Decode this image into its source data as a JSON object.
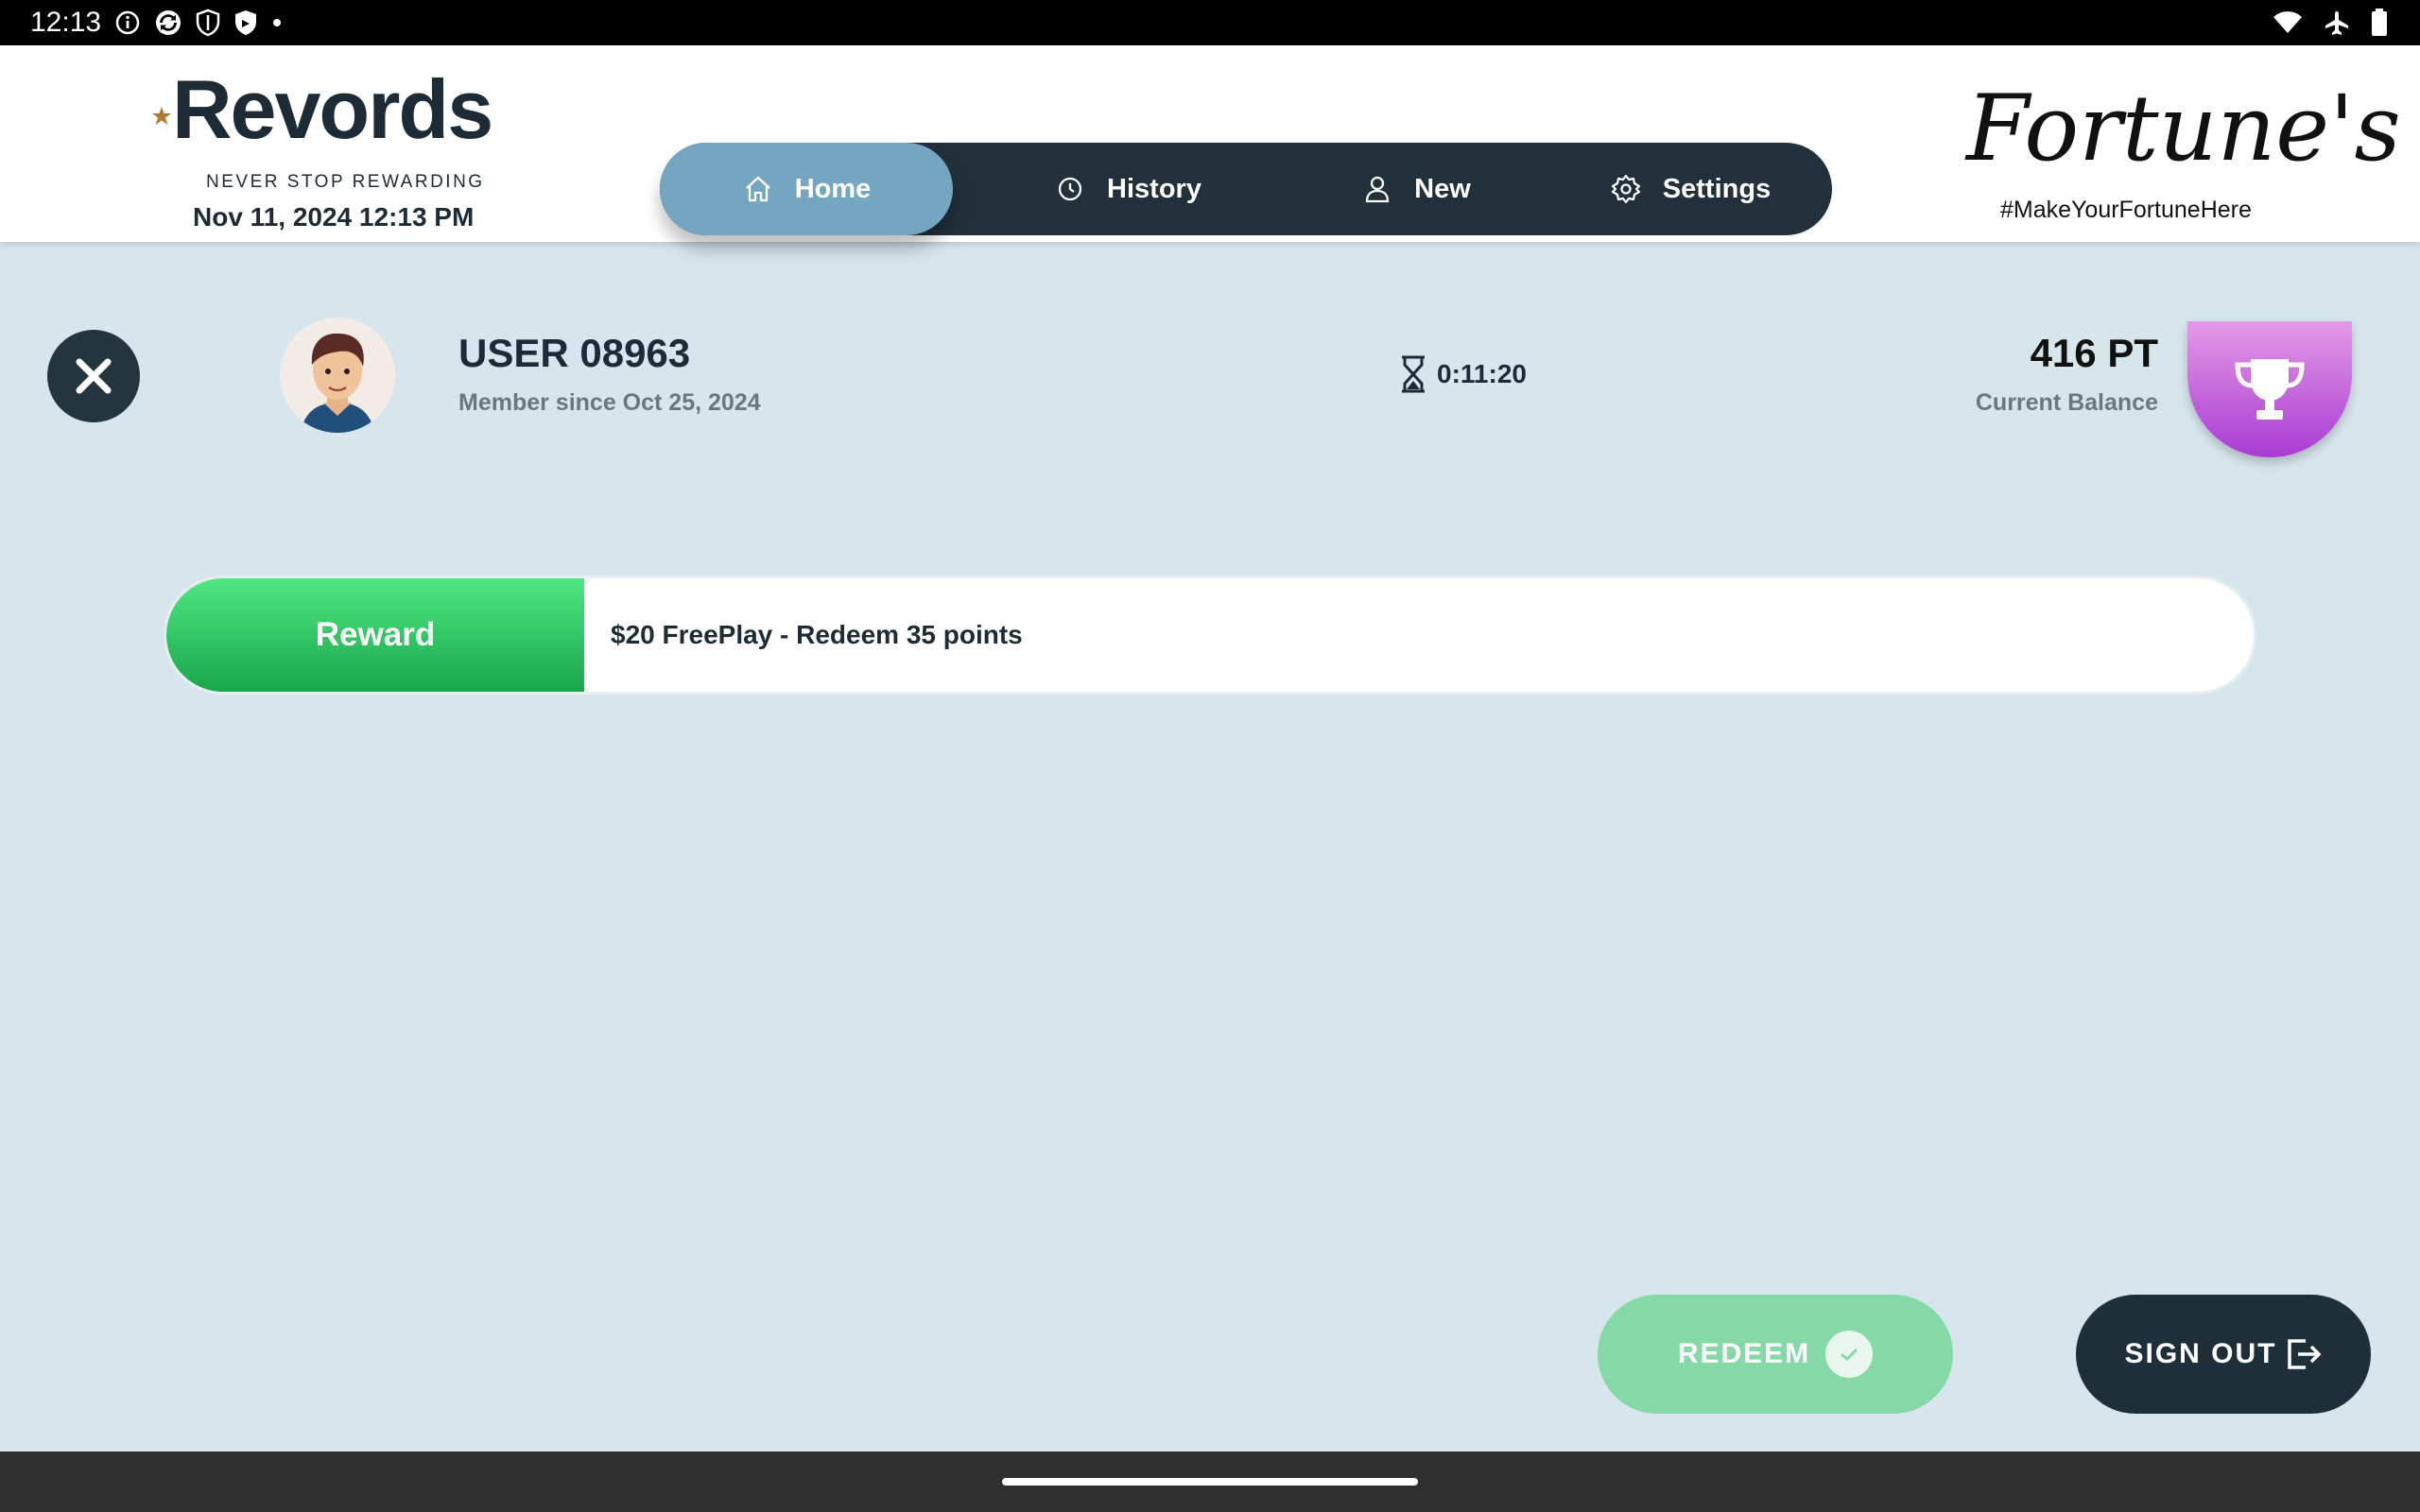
{
  "status_bar": {
    "time": "12:13",
    "icons_left": [
      "info-icon",
      "sync-icon",
      "shield-icon",
      "shield-check-icon",
      "dot-icon"
    ],
    "icons_right": [
      "wifi-icon",
      "airplane-icon",
      "battery-icon"
    ]
  },
  "header": {
    "brand_name": "Revords",
    "brand_tagline": "NEVER STOP REWARDING",
    "datetime": "Nov 11, 2024 12:13 PM",
    "nav": [
      {
        "label": "Home",
        "icon": "home-icon",
        "active": true
      },
      {
        "label": "History",
        "icon": "history-icon",
        "active": false
      },
      {
        "label": "New",
        "icon": "user-icon",
        "active": false
      },
      {
        "label": "Settings",
        "icon": "gear-icon",
        "active": false
      }
    ],
    "partner_name": "Fortune's",
    "partner_tagline": "#MakeYourFortuneHere"
  },
  "member": {
    "name": "USER 08963",
    "member_since": "Member since Oct 25, 2024",
    "session_timer": "0:11:20",
    "balance": "416 PT",
    "balance_label": "Current Balance"
  },
  "reward": {
    "tag_label": "Reward",
    "description": "$20 FreePlay - Redeem 35 points"
  },
  "actions": {
    "redeem_label": "REDEEM",
    "signout_label": "SIGN OUT"
  },
  "colors": {
    "background": "#d7e5ec",
    "nav_dark": "#21303b",
    "nav_active": "#74a6c2",
    "reward_green": "#1aa54a",
    "redeem_disabled": "#85d9a6",
    "trophy_purple": "#a93bd3",
    "brand_gold": "#b07a35"
  }
}
